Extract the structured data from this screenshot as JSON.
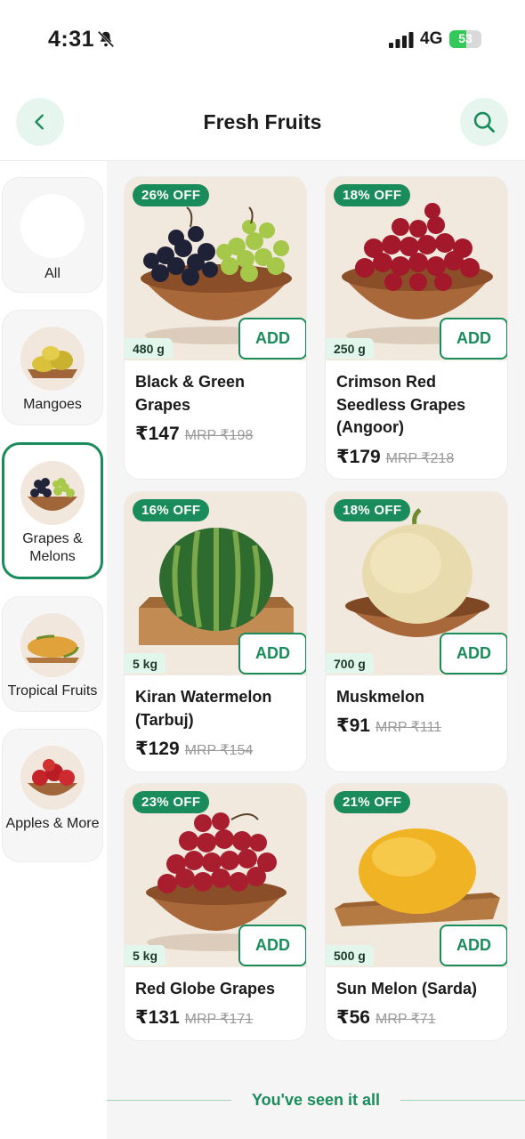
{
  "status_bar": {
    "time": "4:31",
    "network": "4G",
    "battery": "53",
    "battery_level": 0.53
  },
  "header": {
    "title": "Fresh Fruits"
  },
  "sidebar": {
    "items": [
      {
        "label": "All",
        "icon": "blank-circle"
      },
      {
        "label": "Mangoes",
        "icon": "mango-plate"
      },
      {
        "label": "Grapes & Melons",
        "icon": "grapes-bowl",
        "active": true
      },
      {
        "label": "Tropical Fruits",
        "icon": "papaya-plate"
      },
      {
        "label": "Apples & More",
        "icon": "apple-bowl"
      }
    ]
  },
  "products": [
    {
      "discount": "26% OFF",
      "weight": "480 g",
      "add": "ADD",
      "name": "Black & Green Grapes",
      "price": "₹147",
      "mrp": "MRP ₹198",
      "image": "black-green-grapes"
    },
    {
      "discount": "18% OFF",
      "weight": "250 g",
      "add": "ADD",
      "name": "Crimson Red Seedless Grapes (Angoor)",
      "price": "₹179",
      "mrp": "MRP ₹218",
      "image": "crimson-grapes"
    },
    {
      "discount": "16% OFF",
      "weight": "5 kg",
      "add": "ADD",
      "name": "Kiran Watermelon (Tarbuj)",
      "price": "₹129",
      "mrp": "MRP ₹154",
      "image": "watermelon"
    },
    {
      "discount": "18% OFF",
      "weight": "700 g",
      "add": "ADD",
      "name": "Muskmelon",
      "price": "₹91",
      "mrp": "MRP ₹111",
      "image": "muskmelon"
    },
    {
      "discount": "23% OFF",
      "weight": "5 kg",
      "add": "ADD",
      "name": "Red Globe Grapes",
      "price": "₹131",
      "mrp": "MRP ₹171",
      "image": "red-globe-grapes"
    },
    {
      "discount": "21% OFF",
      "weight": "500 g",
      "add": "ADD",
      "name": "Sun Melon (Sarda)",
      "price": "₹56",
      "mrp": "MRP ₹71",
      "image": "sun-melon"
    }
  ],
  "footer": {
    "end_text": "You've seen it all"
  },
  "colors": {
    "brand_green": "#1a8c5b",
    "badge_bg": "#1a8c5b",
    "weight_bg": "#e3f6ec",
    "icon_button_bg": "#e6f6ef"
  }
}
